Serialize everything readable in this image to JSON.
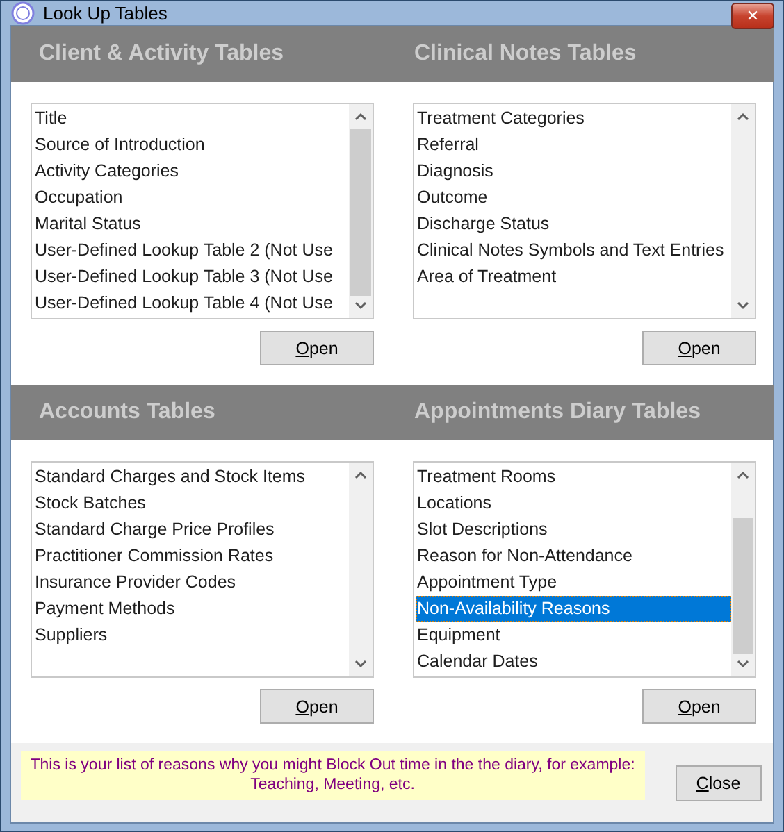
{
  "window": {
    "title": "Look Up Tables",
    "close_label": "✕"
  },
  "sections": [
    {
      "title": "Client & Activity Tables",
      "button": "Open",
      "items": [
        {
          "label": "Title",
          "selected": false
        },
        {
          "label": "Source of Introduction",
          "selected": false
        },
        {
          "label": "Activity Categories",
          "selected": false
        },
        {
          "label": "Occupation",
          "selected": false
        },
        {
          "label": "Marital Status",
          "selected": false
        },
        {
          "label": "User-Defined Lookup Table 2 (Not Use",
          "selected": false
        },
        {
          "label": "User-Defined Lookup Table 3 (Not Use",
          "selected": false
        },
        {
          "label": "User-Defined Lookup Table 4 (Not Use",
          "selected": false
        }
      ]
    },
    {
      "title": "Clinical Notes Tables",
      "button": "Open",
      "items": [
        {
          "label": "Treatment Categories",
          "selected": false
        },
        {
          "label": "Referral",
          "selected": false
        },
        {
          "label": "Diagnosis",
          "selected": false
        },
        {
          "label": "Outcome",
          "selected": false
        },
        {
          "label": "Discharge Status",
          "selected": false
        },
        {
          "label": "Clinical Notes Symbols and Text Entries",
          "selected": false
        },
        {
          "label": "Area of Treatment",
          "selected": false
        }
      ]
    },
    {
      "title": "Accounts Tables",
      "button": "Open",
      "items": [
        {
          "label": "Standard Charges and Stock Items",
          "selected": false
        },
        {
          "label": "Stock Batches",
          "selected": false
        },
        {
          "label": "Standard Charge Price Profiles",
          "selected": false
        },
        {
          "label": "Practitioner Commission Rates",
          "selected": false
        },
        {
          "label": "Insurance Provider Codes",
          "selected": false
        },
        {
          "label": "Payment Methods",
          "selected": false
        },
        {
          "label": "Suppliers",
          "selected": false
        }
      ]
    },
    {
      "title": "Appointments Diary Tables",
      "button": "Open",
      "items": [
        {
          "label": "Treatment Rooms",
          "selected": false
        },
        {
          "label": "Locations",
          "selected": false
        },
        {
          "label": "Slot Descriptions",
          "selected": false
        },
        {
          "label": "Reason for Non-Attendance",
          "selected": false
        },
        {
          "label": "Appointment Type",
          "selected": false
        },
        {
          "label": "Non-Availability Reasons",
          "selected": true
        },
        {
          "label": "Equipment",
          "selected": false
        },
        {
          "label": "Calendar Dates",
          "selected": false
        }
      ]
    }
  ],
  "hint": [
    "This is your list of reasons why you might Block Out time in the the diary, for example:",
    "Teaching, Meeting, etc."
  ],
  "close_button": "Close"
}
